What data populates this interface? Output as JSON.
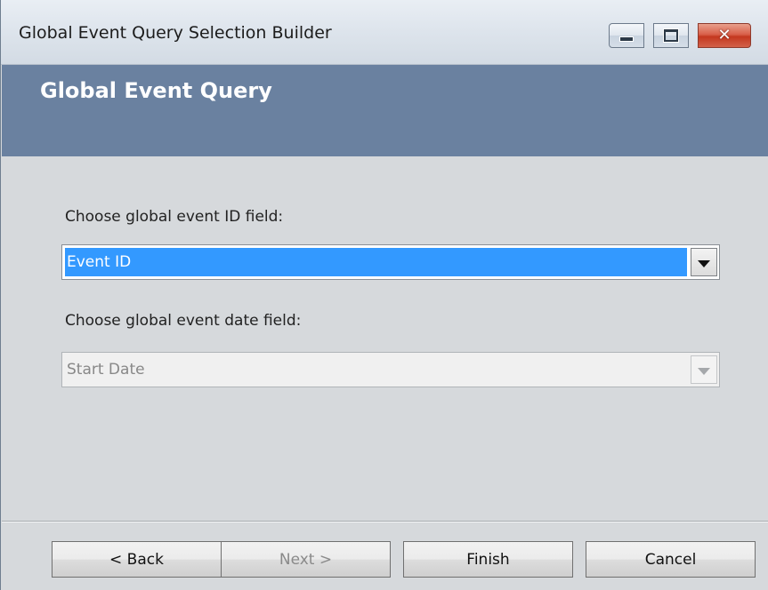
{
  "window": {
    "title": "Global Event Query Selection Builder",
    "minimize_icon": "minimize-icon",
    "maximize_icon": "maximize-icon",
    "close_icon": "close-icon",
    "close_glyph": "✕"
  },
  "banner": {
    "title": "Global Event Query"
  },
  "form": {
    "id_field_label": "Choose global event ID field:",
    "id_field_value": "Event ID",
    "date_field_label": "Choose global event date field:",
    "date_field_value": "Start Date"
  },
  "buttons": {
    "back": "< Back",
    "next": "Next >",
    "finish": "Finish",
    "cancel": "Cancel"
  },
  "colors": {
    "banner": "#6a81a0",
    "selection": "#3399ff",
    "close_button": "#c4381f"
  }
}
